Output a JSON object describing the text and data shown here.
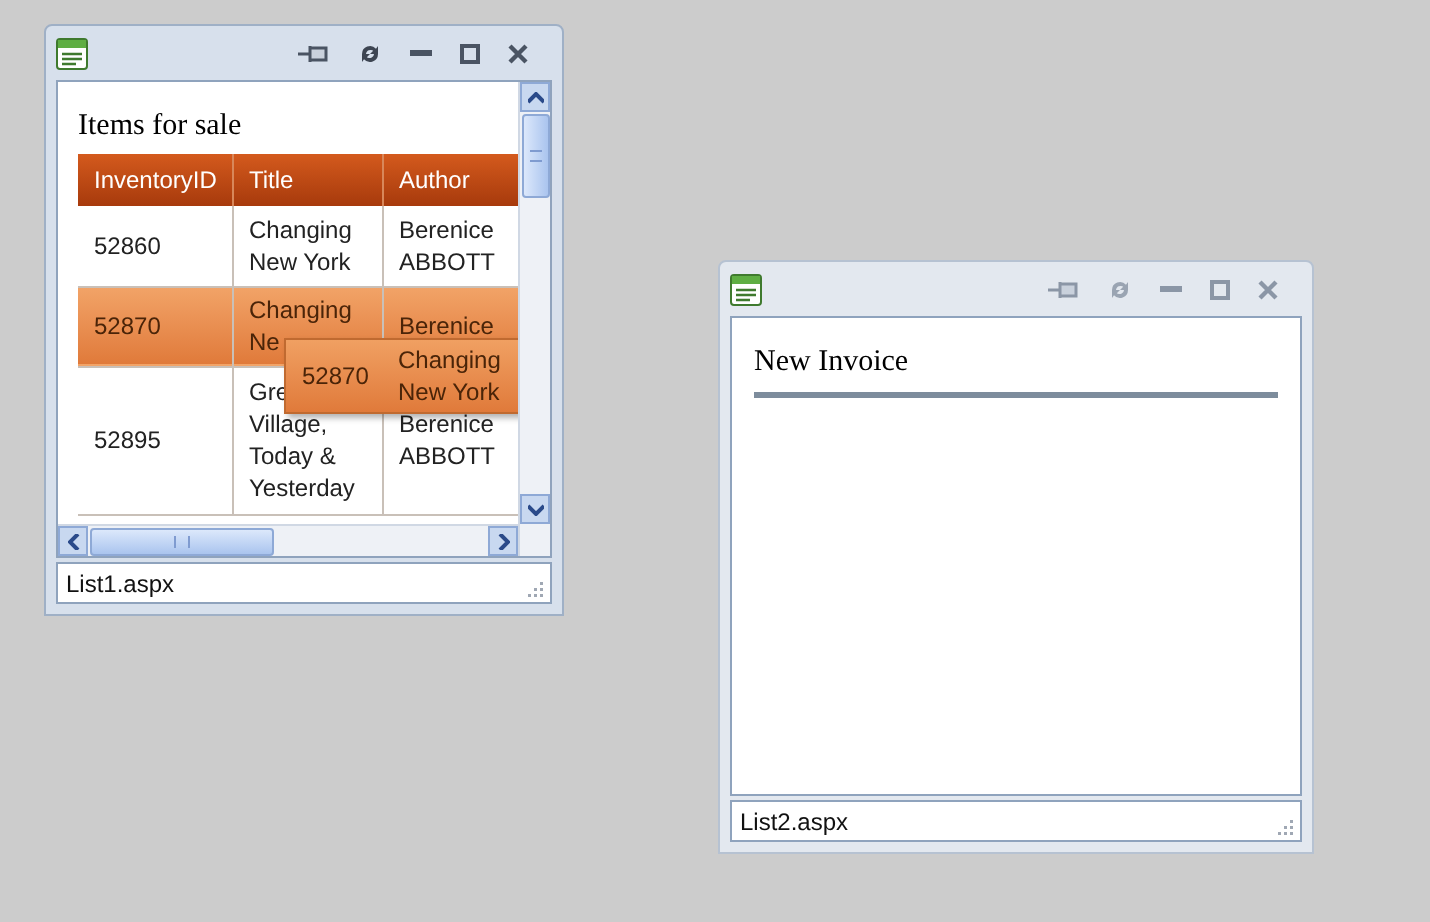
{
  "windows": [
    {
      "active": true,
      "page": {
        "kind": "list",
        "heading": "Items for sale",
        "table": {
          "columns": [
            "InventoryID",
            "Title",
            "Author"
          ],
          "rows": [
            {
              "selected": false,
              "cells": [
                "52860",
                "Changing New York",
                "Berenice ABBOTT"
              ]
            },
            {
              "selected": true,
              "cells": [
                "52870",
                "Changing Ne",
                "Berenice"
              ]
            },
            {
              "selected": false,
              "cells": [
                "52895",
                "Gre Village, Today & Yesterday",
                "Berenice ABBOTT"
              ]
            }
          ]
        },
        "drag_preview": {
          "cells": [
            "52870",
            "Changing New York"
          ]
        }
      },
      "status_bar": "List1.aspx"
    },
    {
      "active": false,
      "page": {
        "kind": "form",
        "heading": "New Invoice"
      },
      "status_bar": "List2.aspx"
    }
  ]
}
